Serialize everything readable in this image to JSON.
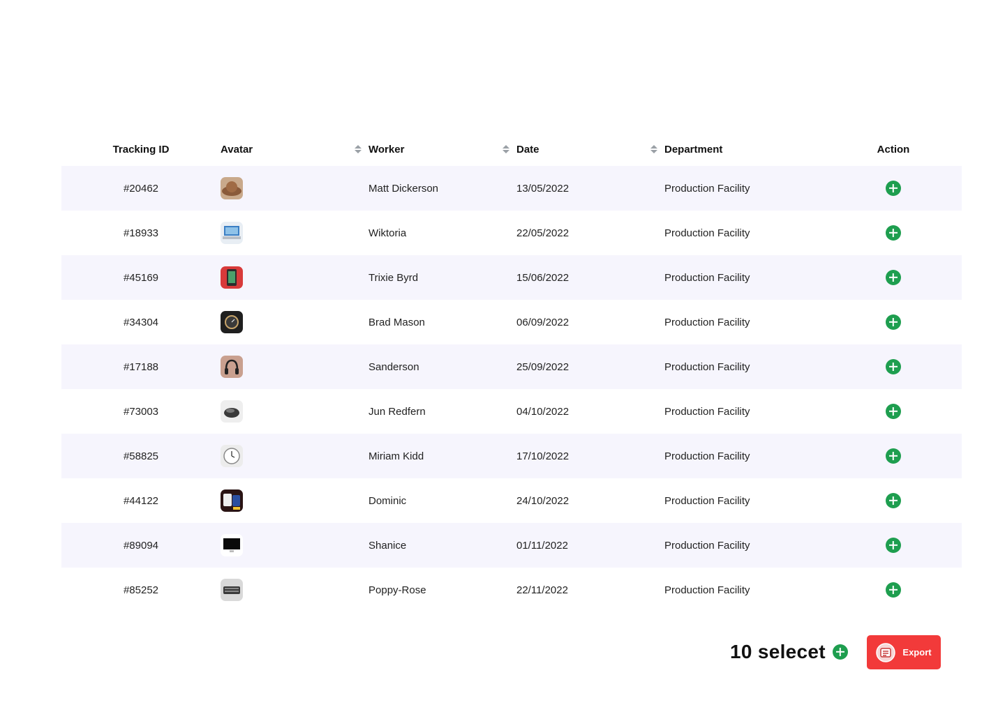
{
  "table": {
    "headers": {
      "tracking_id": "Tracking ID",
      "avatar": "Avatar",
      "worker": "Worker",
      "date": "Date",
      "department": "Department",
      "action": "Action"
    },
    "rows": [
      {
        "id": "#20462",
        "avatar_icon": "hat-photo",
        "worker": "Matt Dickerson",
        "date": "13/05/2022",
        "department": "Production Facility"
      },
      {
        "id": "#18933",
        "avatar_icon": "laptop-photo",
        "worker": "Wiktoria",
        "date": "22/05/2022",
        "department": "Production Facility"
      },
      {
        "id": "#45169",
        "avatar_icon": "phone-photo",
        "worker": "Trixie Byrd",
        "date": "15/06/2022",
        "department": "Production Facility"
      },
      {
        "id": "#34304",
        "avatar_icon": "watch-photo",
        "worker": "Brad Mason",
        "date": "06/09/2022",
        "department": "Production Facility"
      },
      {
        "id": "#17188",
        "avatar_icon": "headphones-photo",
        "worker": "Sanderson",
        "date": "25/09/2022",
        "department": "Production Facility"
      },
      {
        "id": "#73003",
        "avatar_icon": "mouse-photo",
        "worker": "Jun Redfern",
        "date": "04/10/2022",
        "department": "Production Facility"
      },
      {
        "id": "#58825",
        "avatar_icon": "clock-photo",
        "worker": "Miriam Kidd",
        "date": "17/10/2022",
        "department": "Production Facility"
      },
      {
        "id": "#44122",
        "avatar_icon": "devices-photo",
        "worker": "Dominic",
        "date": "24/10/2022",
        "department": "Production Facility"
      },
      {
        "id": "#89094",
        "avatar_icon": "monitor-photo",
        "worker": "Shanice",
        "date": "01/11/2022",
        "department": "Production Facility"
      },
      {
        "id": "#85252",
        "avatar_icon": "keyboard-photo",
        "worker": "Poppy-Rose",
        "date": "22/11/2022",
        "department": "Production Facility"
      }
    ]
  },
  "footer": {
    "selected_text": "10 selecet",
    "export_label": "Export"
  },
  "colors": {
    "row_stripe": "#f6f5fd",
    "add_green": "#1e9e4f",
    "export_red": "#f23a3a",
    "sort_gray": "#9aa0a6"
  }
}
